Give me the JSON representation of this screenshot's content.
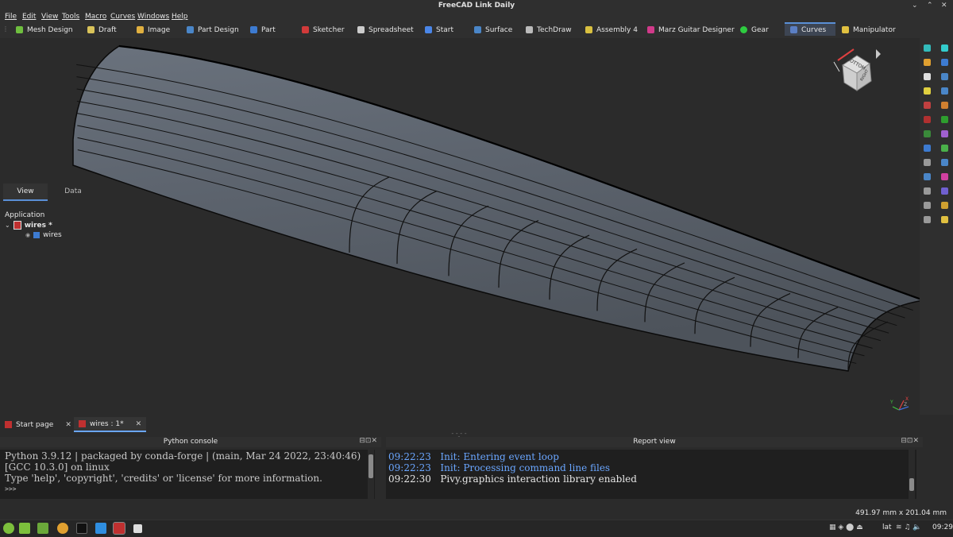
{
  "window": {
    "title": "FreeCAD Link Daily",
    "controls": [
      "⌄",
      "⌃",
      "✕"
    ]
  },
  "menu": [
    "File",
    "Edit",
    "View",
    "Tools",
    "Macro",
    "Curves",
    "Windows",
    "Help"
  ],
  "workbenches": [
    {
      "label": "Mesh Design",
      "icon": "mesh-icon",
      "color": "#6fbf3f"
    },
    {
      "label": "Draft",
      "icon": "draft-icon",
      "color": "#d9c35a"
    },
    {
      "label": "Image",
      "icon": "image-icon",
      "color": "#e0b040"
    },
    {
      "label": "Part Design",
      "icon": "part-design-icon",
      "color": "#4a86c8"
    },
    {
      "label": "Part",
      "icon": "part-icon",
      "color": "#3d7bd1"
    },
    {
      "label": "Sketcher",
      "icon": "sketcher-icon",
      "color": "#d13a3a"
    },
    {
      "label": "Spreadsheet",
      "icon": "spreadsheet-icon",
      "color": "#cccccc"
    },
    {
      "label": "Start",
      "icon": "start-icon",
      "color": "#4a86e8"
    },
    {
      "label": "Surface",
      "icon": "surface-icon",
      "color": "#4a86c8"
    },
    {
      "label": "TechDraw",
      "icon": "techdraw-icon",
      "color": "#bbbbbb"
    },
    {
      "label": "Assembly 4",
      "icon": "assembly-icon",
      "color": "#d9c040"
    },
    {
      "label": "Marz Guitar Designer",
      "icon": "guitar-icon",
      "color": "#d13a8a"
    },
    {
      "label": "Gear",
      "icon": "gear-icon",
      "color": "#2ecc40"
    },
    {
      "label": "Curves",
      "icon": "curves-icon",
      "color": "#5b7fc4"
    },
    {
      "label": "Manipulator",
      "icon": "manipulator-icon",
      "color": "#e0c040"
    }
  ],
  "active_workbench": "Curves",
  "combo": {
    "tabs": [
      "View",
      "Data"
    ],
    "active_tab": "View",
    "section_label": "Application",
    "tree": [
      {
        "label": "wires *",
        "icon": "document-icon",
        "bold": true
      },
      {
        "label": "wires",
        "icon": "part-feature-icon",
        "bold": false
      }
    ]
  },
  "navcube": {
    "face_top": "BOTTOM",
    "face_right": "RIGHT"
  },
  "axis": {
    "labels": [
      "Y",
      "Z",
      "X"
    ]
  },
  "doc_tabs": [
    {
      "label": "Start page",
      "close": "✕"
    },
    {
      "label": "wires : 1*",
      "close": "✕"
    }
  ],
  "python_console": {
    "title": "Python console",
    "lines": [
      "Python 3.9.12 | packaged by conda-forge | (main, Mar 24 2022, 23:40:46)",
      "[GCC 10.3.0] on linux",
      "Type 'help', 'copyright', 'credits' or 'license' for more information.",
      ">>>"
    ]
  },
  "report_view": {
    "title": "Report view",
    "entries": [
      {
        "time": "09:22:23",
        "text": "Init: Entering event loop",
        "color": "#6aa6ff"
      },
      {
        "time": "09:22:23",
        "text": "Init: Processing command line files",
        "color": "#6aa6ff"
      },
      {
        "time": "09:22:30",
        "text": "Pivy.graphics interaction library enabled",
        "color": "#e6e6e6"
      }
    ]
  },
  "status": {
    "dimensions": "491.97 mm x 201.04 mm"
  },
  "taskbar": {
    "keyboard": "lat",
    "clock": "09:29"
  },
  "colors": {
    "accent": "#5a8fd6",
    "viewport_bg": "#2b2b2b",
    "surface_fill": "#5f6670",
    "edge_color": "#0a0a0a"
  }
}
